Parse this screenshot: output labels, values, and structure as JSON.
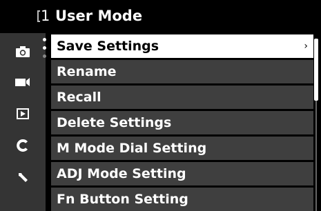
{
  "header": {
    "number": "1",
    "title": "User Mode"
  },
  "sidebar": {
    "icons": [
      "camera-icon",
      "video-icon",
      "playback-icon",
      "custom-c-icon",
      "wrench-icon"
    ],
    "active_index": 0
  },
  "menu": {
    "items": [
      {
        "label": "Save Settings",
        "selected": true,
        "has_submenu": true
      },
      {
        "label": "Rename"
      },
      {
        "label": "Recall"
      },
      {
        "label": "Delete Settings"
      },
      {
        "label": "M Mode Dial Setting"
      },
      {
        "label": "ADJ Mode Setting"
      },
      {
        "label": "Fn Button Setting"
      }
    ],
    "chevron": "›"
  },
  "colors": {
    "selected_bg": "#ffffff",
    "item_bg": "#3f3f3f",
    "sidebar_bg": "#343434"
  }
}
